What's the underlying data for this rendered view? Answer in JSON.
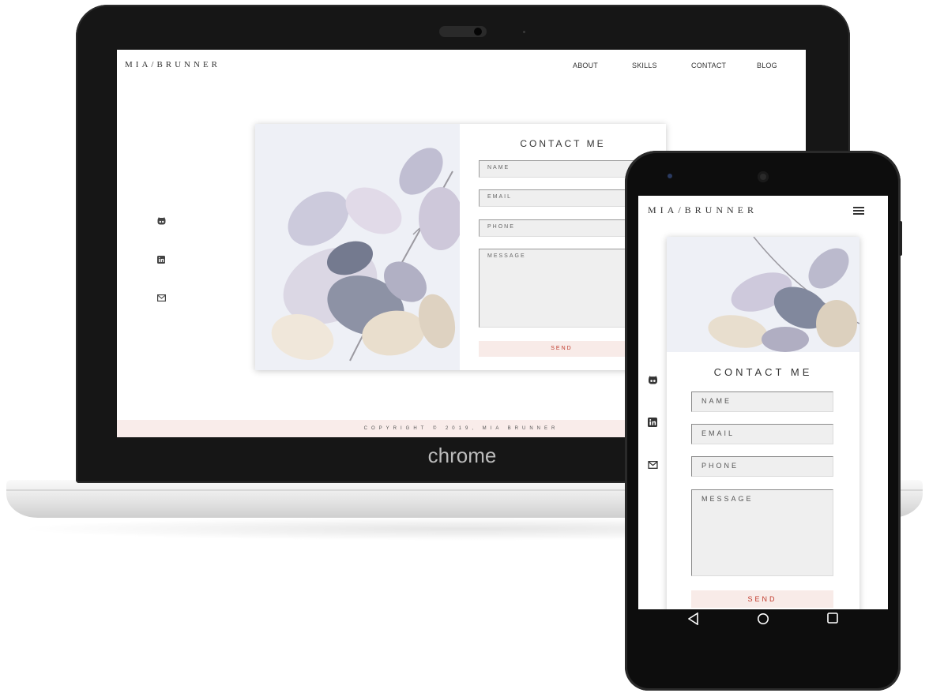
{
  "desktop": {
    "logo": "MIA/BRUNNER",
    "nav": [
      "ABOUT",
      "SKILLS",
      "CONTACT",
      "BLOG"
    ],
    "social_icons": [
      "github-icon",
      "linkedin-icon",
      "mail-icon"
    ],
    "contact": {
      "title": "CONTACT ME",
      "name_placeholder": "NAME",
      "email_placeholder": "EMAIL",
      "phone_placeholder": "PHONE",
      "message_placeholder": "MESSAGE",
      "send_label": "SEND"
    },
    "footer": "COPYRIGHT © 2019, MIA BRUNNER"
  },
  "laptop_brand": "chrome",
  "mobile": {
    "logo": "MIA/BRUNNER",
    "menu_icon": "hamburger-menu-icon",
    "social_icons": [
      "github-icon",
      "linkedin-icon",
      "mail-icon"
    ],
    "contact": {
      "title": "CONTACT ME",
      "name_placeholder": "NAME",
      "email_placeholder": "EMAIL",
      "phone_placeholder": "PHONE",
      "message_placeholder": "MESSAGE",
      "send_label": "SEND"
    },
    "system_nav": [
      "back-icon",
      "home-icon",
      "recents-icon"
    ]
  },
  "colors": {
    "accent_pink": "#f8ebe8",
    "send_text": "#c0392b",
    "field_bg": "#efefef",
    "device_black": "#161616"
  }
}
